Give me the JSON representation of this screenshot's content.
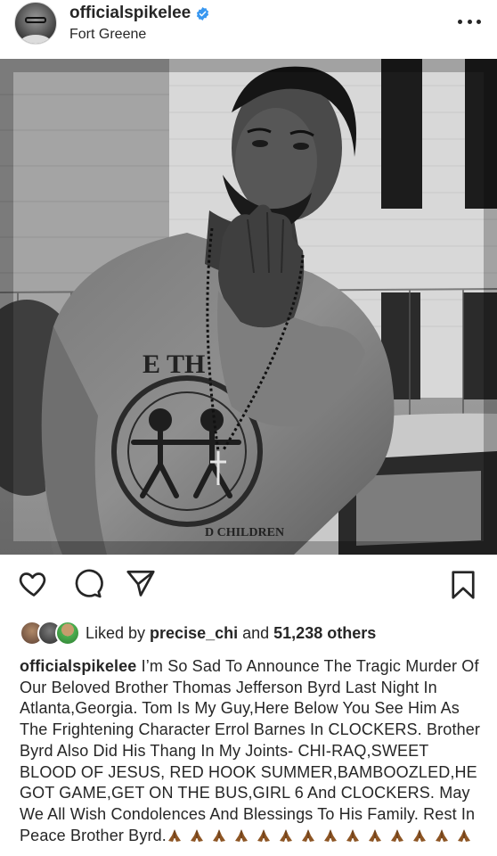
{
  "post": {
    "username": "officialspikelee",
    "location": "Fort Greene",
    "verified": true
  },
  "photo": {
    "shirt_text_top": "E TH",
    "shirt_text_bottom": "D CHILDREN"
  },
  "actions": {
    "like_icon": "heart-icon",
    "comment_icon": "comment-icon",
    "share_icon": "send-icon",
    "save_icon": "bookmark-icon"
  },
  "likes": {
    "prefix": "Liked by ",
    "user": "precise_chi",
    "middle": " and ",
    "others": "51,238 others"
  },
  "caption": {
    "author": "officialspikelee",
    "text": " I’m So Sad To Announce The Tragic Murder Of Our Beloved Brother Thomas Jefferson Byrd Last Night In Atlanta,Georgia. Tom Is My Guy,Here Below You See Him As The Frightening Character Errol Barnes In CLOCKERS. Brother Byrd Also Did His Thang In My Joints- CHI-RAQ,SWEET BLOOD OF JESUS, RED HOOK SUMMER,BAMBOOZLED,HE GOT GAME,GET ON THE BUS,GIRL 6 And CLOCKERS. May We All Wish Condolences And Blessings To His Family. Rest In Peace Brother Byrd.",
    "prayer_count": 14
  },
  "colors": {
    "text": "#262626",
    "verified_blue": "#3897f0",
    "skin_tone": "#8d5524"
  }
}
